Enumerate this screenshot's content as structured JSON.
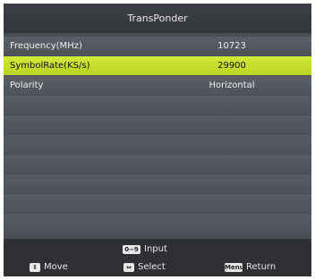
{
  "header": {
    "title": "TransPonder"
  },
  "rows": [
    {
      "label": "Frequency(MHz)",
      "value": "10723",
      "selected": false
    },
    {
      "label": "SymbolRate(KS/s)",
      "value": "29900",
      "selected": true
    },
    {
      "label": "Polarity",
      "value": "Horizontal",
      "selected": false
    }
  ],
  "footer": {
    "input": {
      "key": "0~9",
      "label": "Input"
    },
    "move": {
      "key": "⇕",
      "label": "Move"
    },
    "select": {
      "key": "⇔",
      "label": "Select"
    },
    "return": {
      "key": "Menu",
      "label": "Return"
    }
  },
  "colors": {
    "selected_row": "#c6e02a",
    "background": "#4a4e55",
    "footer": "#2e3034"
  }
}
